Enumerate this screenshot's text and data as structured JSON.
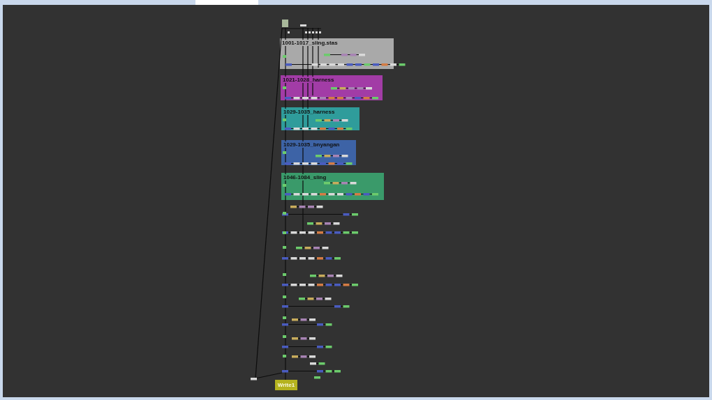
{
  "node_graph": {
    "backdrops": [
      {
        "label": "1001-1017_sling.stas",
        "color": "#a9a9a9"
      },
      {
        "label": "1021-1028_harness",
        "color": "#a23ca6"
      },
      {
        "label": "1029-1035_harness",
        "color": "#2f9c9b"
      },
      {
        "label": "1029-1035_bnyangan",
        "color": "#3d63a6"
      },
      {
        "label": "1046-1084_sling",
        "color": "#3a9a6a"
      }
    ],
    "write_node": {
      "label": "Write1",
      "color": "#b5b31f"
    }
  }
}
